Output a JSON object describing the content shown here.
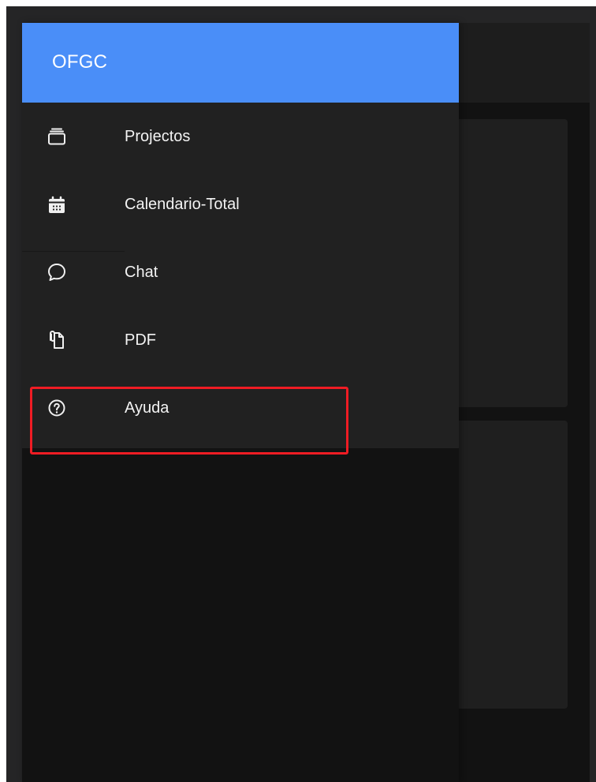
{
  "drawer": {
    "title": "OFGC",
    "items": [
      {
        "label": "Projectos",
        "icon": "layers-icon"
      },
      {
        "label": "Calendario-Total",
        "icon": "calendar-icon"
      },
      {
        "label": "Chat",
        "icon": "chat-bubble-icon"
      },
      {
        "label": "PDF",
        "icon": "attachment-file-icon"
      },
      {
        "label": "Ayuda",
        "icon": "help-circle-icon"
      }
    ]
  },
  "colors": {
    "header": "#4a8ef8",
    "menu_bg": "#212121",
    "app_bg": "#121212",
    "highlight": "#ef1c24"
  }
}
